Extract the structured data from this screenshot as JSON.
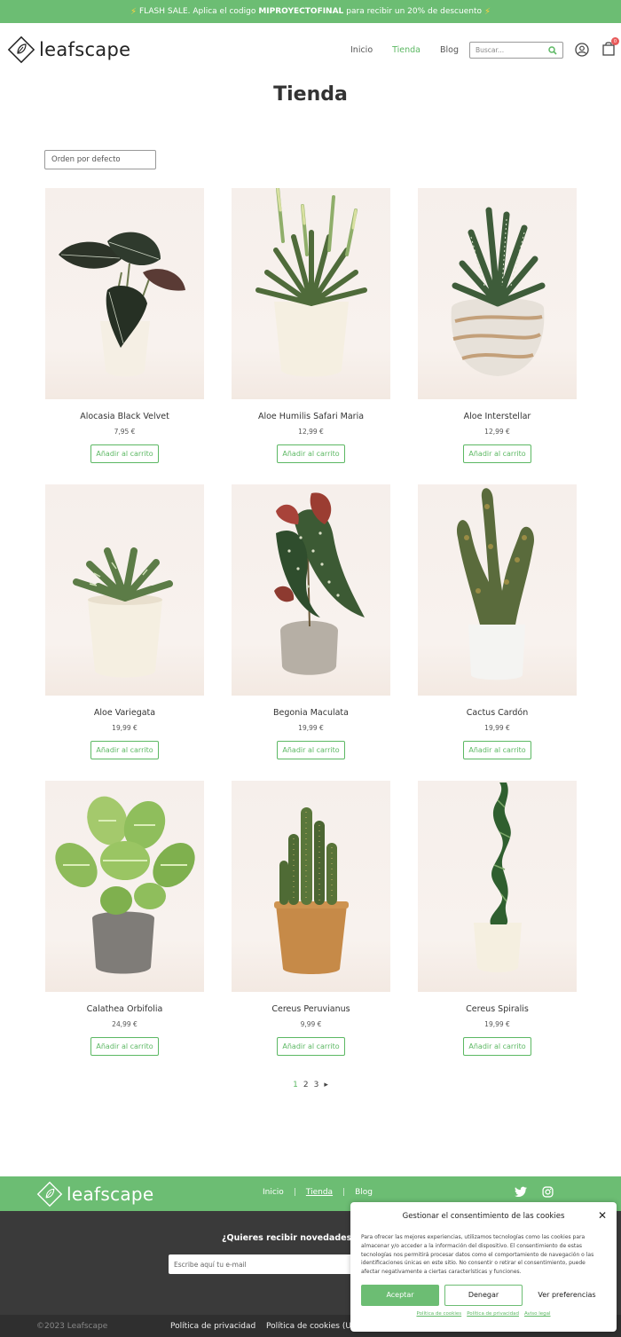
{
  "flash_bar": {
    "prefix": "FLASH SALE. Aplica el codigo",
    "code": "MIPROYECTOFINAL",
    "suffix": "para recibir un 20% de descuento"
  },
  "header": {
    "logo_text": "leafscape",
    "nav": [
      {
        "label": "Inicio",
        "active": false
      },
      {
        "label": "Tienda",
        "active": true
      },
      {
        "label": "Blog",
        "active": false
      }
    ],
    "search_placeholder": "Buscar...",
    "cart_count": "0"
  },
  "page": {
    "title": "Tienda",
    "sort_label": "Orden por defecto"
  },
  "products": [
    {
      "name": "Alocasia Black Velvet",
      "price": "7,95 €",
      "button": "Añadir al carrito"
    },
    {
      "name": "Aloe Humilis Safari Maria",
      "price": "12,99 €",
      "button": "Añadir al carrito"
    },
    {
      "name": "Aloe Interstellar",
      "price": "12,99 €",
      "button": "Añadir al carrito"
    },
    {
      "name": "Aloe Variegata",
      "price": "19,99 €",
      "button": "Añadir al carrito"
    },
    {
      "name": "Begonia Maculata",
      "price": "19,99 €",
      "button": "Añadir al carrito"
    },
    {
      "name": "Cactus Cardón",
      "price": "19,99 €",
      "button": "Añadir al carrito"
    },
    {
      "name": "Calathea Orbifolia",
      "price": "24,99 €",
      "button": "Añadir al carrito"
    },
    {
      "name": "Cereus Peruvianus",
      "price": "9,99 €",
      "button": "Añadir al carrito"
    },
    {
      "name": "Cereus Spiralis",
      "price": "19,99 €",
      "button": "Añadir al carrito"
    }
  ],
  "pagination": {
    "pages": [
      "1",
      "2",
      "3"
    ],
    "current": "1",
    "next": "▸"
  },
  "footer": {
    "logo_text": "leafscape",
    "nav": [
      "Inicio",
      "Tienda",
      "Blog"
    ],
    "newsletter_title": "¿Quieres recibir novedades y ofertas?",
    "newsletter_placeholder": "Escribe aquí tu e-mail",
    "copyright": "©2023 Leafscape",
    "links": [
      "Política de privacidad",
      "Política de cookies (UE)"
    ]
  },
  "cookie_banner": {
    "title": "Gestionar el consentimiento de las cookies",
    "text": "Para ofrecer las mejores experiencias, utilizamos tecnologías como las cookies para almacenar y/o acceder a la información del dispositivo. El consentimiento de estas tecnologías nos permitirá procesar datos como el comportamiento de navegación o las identificaciones únicas en este sitio. No consentir o retirar el consentimiento, puede afectar negativamente a ciertas características y funciones.",
    "accept": "Aceptar",
    "deny": "Denegar",
    "preferences": "Ver preferencias",
    "links": [
      "Política de cookies",
      "Política de privacidad",
      "Aviso legal"
    ]
  },
  "colors": {
    "accent": "#6cbd73",
    "accent_text": "#5cb863",
    "dark": "#3a3a3a"
  }
}
